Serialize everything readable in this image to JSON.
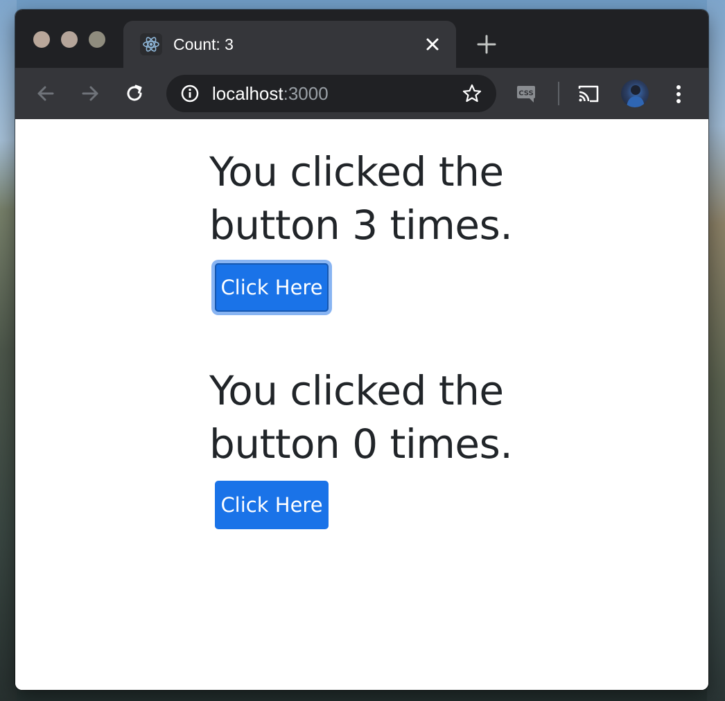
{
  "browser": {
    "tab": {
      "title": "Count: 3",
      "favicon": "react-icon"
    },
    "address": {
      "host": "localhost",
      "port": ":3000"
    },
    "extension_badge": "CSS"
  },
  "counters": [
    {
      "heading": "You clicked the button 3 times.",
      "button_label": "Click Here",
      "count": 3,
      "focused": true
    },
    {
      "heading": "You clicked the button 0 times.",
      "button_label": "Click Here",
      "count": 0,
      "focused": false
    }
  ],
  "colors": {
    "button": "#1a73e8",
    "heading_text": "#212529",
    "chrome_dark": "#202124",
    "chrome_toolbar": "#35363a"
  }
}
